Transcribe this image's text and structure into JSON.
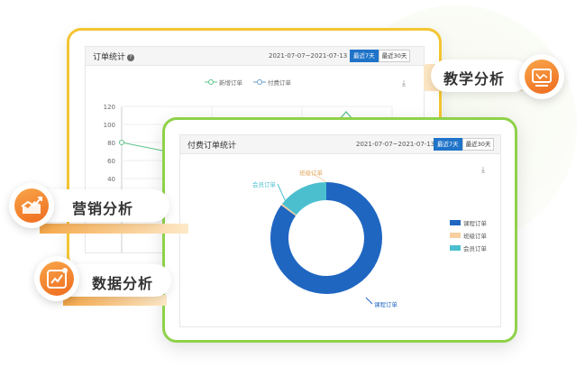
{
  "back_panel": {
    "title": "订单统计",
    "date_range": "2021-07-07~2021-07-13",
    "buttons": [
      "最近7天",
      "最近30天"
    ],
    "legend": [
      "新增订单",
      "付费订单"
    ],
    "y_ticks": [
      "120",
      "100",
      "80",
      "60",
      "40"
    ],
    "colors": {
      "new_orders": "#5cc38a",
      "paid_orders": "#6aa0cc"
    }
  },
  "front_panel": {
    "title": "付费订单统计",
    "date_range": "2021-07-07~2021-07-13",
    "buttons": [
      "最近7天",
      "最近30天"
    ],
    "chart_data": {
      "type": "pie",
      "title": "",
      "categories": [
        "课程订单",
        "班级订单",
        "会员订单"
      ],
      "values": [
        85,
        0.5,
        14.5
      ],
      "colors": [
        "#1f66c1",
        "#f7cfa0",
        "#4cbfcf"
      ],
      "legend_position": "right"
    }
  },
  "features": {
    "teaching": "教学分析",
    "marketing": "营销分析",
    "data": "数据分析"
  },
  "icons": {
    "help": "?",
    "download": "⤓"
  }
}
